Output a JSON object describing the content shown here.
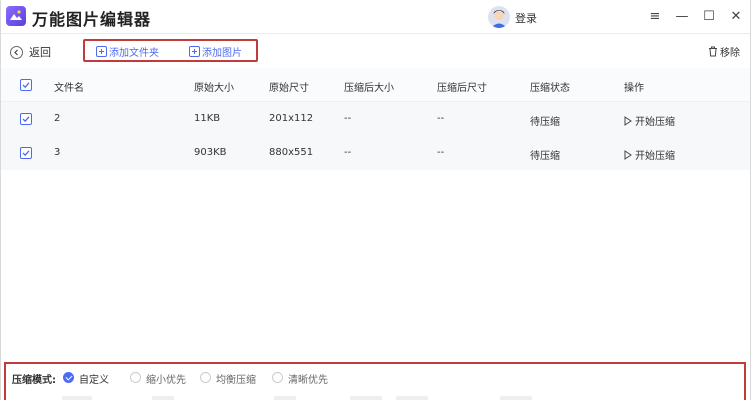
{
  "app": {
    "title": "万能图片编辑器",
    "login_label": "登录"
  },
  "window": {
    "menu_icon": "≡",
    "minimize": "—",
    "maximize": "☐",
    "close": "✕"
  },
  "toolbar": {
    "back_label": "返回",
    "add_folder_label": "添加文件夹",
    "add_image_label": "添加图片",
    "remove_label": "移除"
  },
  "table": {
    "headers": [
      "文件名",
      "原始大小",
      "原始尺寸",
      "压缩后大小",
      "压缩后尺寸",
      "压缩状态",
      "操作"
    ],
    "rows": [
      {
        "name": "2",
        "size": "11KB",
        "dims": "201x112",
        "new_size": "--",
        "new_dims": "--",
        "status": "待压缩",
        "action": "开始压缩"
      },
      {
        "name": "3",
        "size": "903KB",
        "dims": "880x551",
        "new_size": "--",
        "new_dims": "--",
        "status": "待压缩",
        "action": "开始压缩"
      }
    ]
  },
  "compression": {
    "mode_label": "压缩模式:",
    "options": [
      "自定义",
      "缩小优先",
      "均衡压缩",
      "清晰优先"
    ],
    "selected": "自定义"
  },
  "colors": {
    "accent": "#4d6bf2",
    "highlight_border": "#c23b3b"
  }
}
